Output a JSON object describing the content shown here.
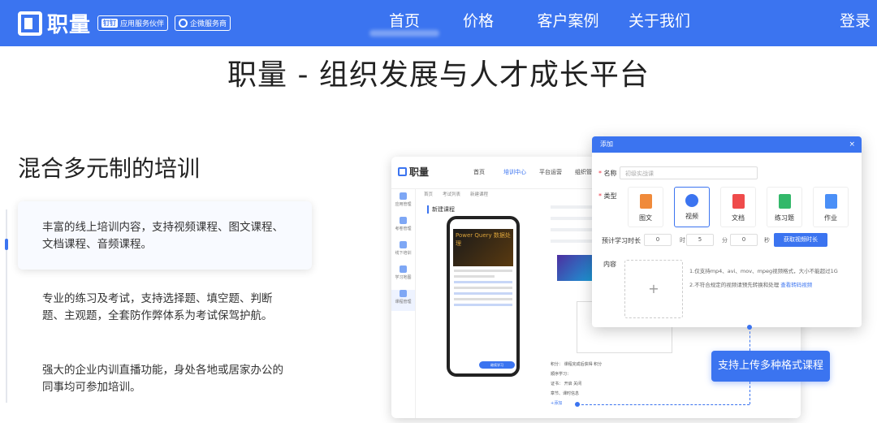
{
  "header": {
    "brand": "职量",
    "badge1_tag": "钉钉",
    "badge1_label": "应用服务伙伴",
    "badge2_label": "企微服务商",
    "nav": [
      "首页",
      "价格",
      "客户案例",
      "关于我们"
    ],
    "active_nav": "首页",
    "login": "登录"
  },
  "page_title": "职量 - 组织发展与人才成长平台",
  "section": {
    "title": "混合多元制的培训",
    "features": [
      "丰富的线上培训内容，支持视频课程、图文课程、文档课程、音频课程。",
      "专业的练习及考试，支持选择题、填空题、判断题、主观题，全套防作弊体系为考试保驾护航。",
      "强大的企业内训直播功能，身处各地或居家办公的同事均可参加培训。"
    ]
  },
  "mock": {
    "brand": "职量",
    "nav": [
      "首页",
      "培训中心",
      "平台运营",
      "组织管理"
    ],
    "sidebar": [
      "应用管理",
      "考卷管理",
      "线下培训",
      "学习地图",
      "课程管理"
    ],
    "tabs": [
      "首页",
      "考试列表",
      "新建课程"
    ],
    "new_course": "新建课程",
    "phone_video_text": "Power Query 数据处理",
    "phone_button": "继续学习",
    "bottom_lines": [
      "积分：  课程完成后获得  积分",
      "顺序学习：",
      "证书：  开启  关闭",
      "章节、课时信息",
      "+添加"
    ]
  },
  "dialog": {
    "title": "添加",
    "close": "×",
    "name_label": "名称",
    "name_value": "初级实战课",
    "type_label": "类型",
    "types": [
      {
        "label": "图文",
        "color": "#f08a3a"
      },
      {
        "label": "视频",
        "color": "#3b74f0"
      },
      {
        "label": "文档",
        "color": "#ef4b4b"
      },
      {
        "label": "练习题",
        "color": "#33b86a"
      },
      {
        "label": "作业",
        "color": "#4a8ff7"
      }
    ],
    "selected_type": "视频",
    "duration_label": "预计学习时长",
    "hours": "0",
    "hours_unit": "时",
    "minutes": "5",
    "minutes_unit": "分",
    "seconds": "0",
    "seconds_unit": "秒",
    "fetch_button": "获取视频时长",
    "content_label": "内容",
    "upload_plus": "+",
    "tip1": "1.仅支持mp4、avi、mov、mpeg视频格式，大小不能超过1G",
    "tip2": "2.不符合规定的视频请预先转换和处理",
    "tip2_link": "查看转码视频"
  },
  "tooltip": "支持上传多种格式课程",
  "colors": {
    "accent": "#3b74f0"
  }
}
